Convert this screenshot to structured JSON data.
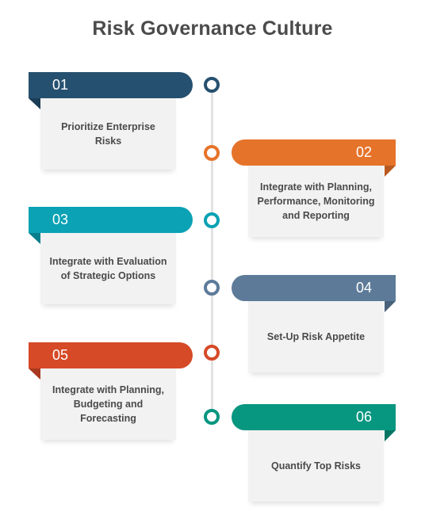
{
  "title": "Risk Governance Culture",
  "colors": {
    "step1": "#26506f",
    "step2": "#e6732a",
    "step3": "#0aa2b4",
    "step4": "#5d7b99",
    "step5": "#d64a27",
    "step6": "#079680"
  },
  "steps": [
    {
      "number": "01",
      "text": "Prioritize Enterprise Risks",
      "side": "left",
      "color": "#26506f"
    },
    {
      "number": "02",
      "text": "Integrate with Planning, Performance, Monitoring and Reporting",
      "side": "right",
      "color": "#e6732a"
    },
    {
      "number": "03",
      "text": "Integrate with Evaluation of Strategic Options",
      "side": "left",
      "color": "#0aa2b4"
    },
    {
      "number": "04",
      "text": "Set-Up Risk Appetite",
      "side": "right",
      "color": "#5d7b99"
    },
    {
      "number": "05",
      "text": "Integrate with Planning, Budgeting and Forecasting",
      "side": "left",
      "color": "#d64a27"
    },
    {
      "number": "06",
      "text": "Quantify Top Risks",
      "side": "right",
      "color": "#079680"
    }
  ]
}
